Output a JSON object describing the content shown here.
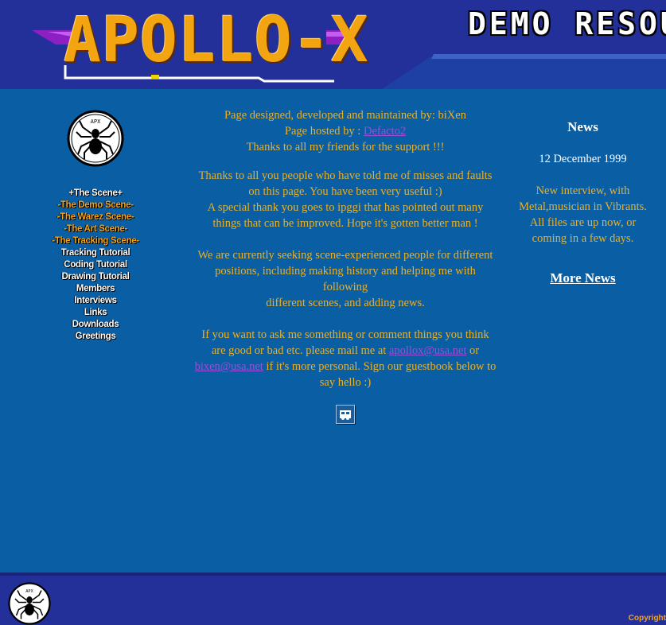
{
  "header": {
    "logo_text": "APOLLO-X",
    "banner_text": "DEMO RESOU"
  },
  "spider_badge": {
    "text": "APX"
  },
  "nav": {
    "items": [
      {
        "label": "+The Scene+",
        "color": "white"
      },
      {
        "label": "-The Demo Scene-",
        "color": "orange"
      },
      {
        "label": "-The Warez Scene-",
        "color": "orange"
      },
      {
        "label": "-The Art Scene-",
        "color": "orange"
      },
      {
        "label": "-The Tracking Scene-",
        "color": "orange"
      },
      {
        "label": "Tracking Tutorial",
        "color": "white"
      },
      {
        "label": "Coding Tutorial",
        "color": "white"
      },
      {
        "label": "Drawing Tutorial",
        "color": "white"
      },
      {
        "label": "Members",
        "color": "white"
      },
      {
        "label": "Interviews",
        "color": "white"
      },
      {
        "label": "Links",
        "color": "white"
      },
      {
        "label": "Downloads",
        "color": "white"
      },
      {
        "label": "Greetings",
        "color": "white"
      }
    ]
  },
  "main": {
    "credits_line": "Page designed, developed and maintained by: biXen",
    "hosted_prefix": "Page hosted by :",
    "hosted_link": "Defacto2",
    "thanks_line": "Thanks to all my friends for the support !!!",
    "para2_line1": "Thanks to all you people who have told me of misses and faults",
    "para2_line2": "on this page. You have been very useful :)",
    "para2_line3": "A special thank you goes to ipggi that has pointed out many things that can be improved. Hope it's gotten better man !",
    "para3_line1": "We are currently seeking scene-experienced people for different positions, including making history and helping me with following",
    "para3_line2": "different scenes, and adding news.",
    "para4_text1": "If you want to ask me something or comment things you think are good or bad etc. please mail me at",
    "email1": "apollox@usa.net",
    "para4_or": "or",
    "email2": "bixen@usa.net",
    "para4_text2": "if it's more personal. Sign our guestbook below to say hello :)"
  },
  "news": {
    "title": "News",
    "date": "12 December 1999",
    "body": "New interview, with Metal,musician in Vibrants. All files are up now, or coming in a few days.",
    "more_label": "More News"
  },
  "footer": {
    "copyright": "Copyright "
  },
  "colors": {
    "page_bg": "#0a5ea3",
    "header_bg": "#23309a",
    "body_text": "#e8b12b",
    "nav_orange": "#f6a317",
    "link": "#9a4fd9"
  }
}
